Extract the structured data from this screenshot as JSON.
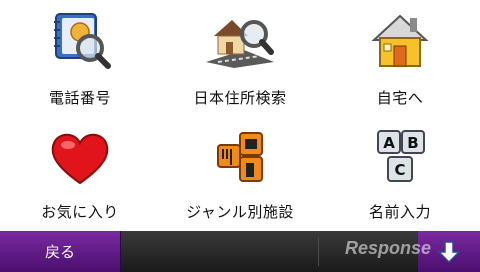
{
  "menu": {
    "items": [
      {
        "label": "電話番号",
        "icon": "address-book-search-icon"
      },
      {
        "label": "日本住所検索",
        "icon": "house-road-search-icon"
      },
      {
        "label": "自宅へ",
        "icon": "home-icon"
      },
      {
        "label": "お気に入り",
        "icon": "heart-icon"
      },
      {
        "label": "ジャンル別施設",
        "icon": "poi-category-icon"
      },
      {
        "label": "名前入力",
        "icon": "abc-keys-icon"
      }
    ]
  },
  "footer": {
    "back_label": "戻る",
    "scroll_icon": "arrow-down-icon"
  },
  "watermark": "Response"
}
